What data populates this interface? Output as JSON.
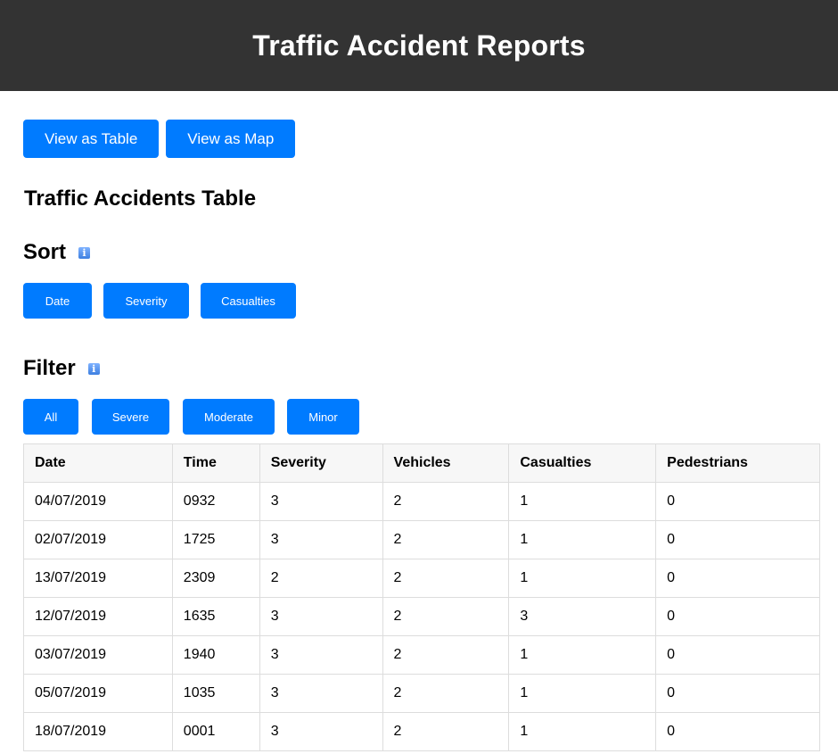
{
  "header": {
    "title": "Traffic Accident Reports"
  },
  "view_buttons": {
    "table": "View as Table",
    "map": "View as Map"
  },
  "table_title": "Traffic Accidents Table",
  "sort": {
    "label": "Sort",
    "buttons": [
      "Date",
      "Severity",
      "Casualties"
    ]
  },
  "filter": {
    "label": "Filter",
    "buttons": [
      "All",
      "Severe",
      "Moderate",
      "Minor"
    ]
  },
  "info_icon_glyph": "i",
  "table": {
    "headers": [
      "Date",
      "Time",
      "Severity",
      "Vehicles",
      "Casualties",
      "Pedestrians"
    ],
    "rows": [
      [
        "04/07/2019",
        "0932",
        "3",
        "2",
        "1",
        "0"
      ],
      [
        "02/07/2019",
        "1725",
        "3",
        "2",
        "1",
        "0"
      ],
      [
        "13/07/2019",
        "2309",
        "2",
        "2",
        "1",
        "0"
      ],
      [
        "12/07/2019",
        "1635",
        "3",
        "2",
        "3",
        "0"
      ],
      [
        "03/07/2019",
        "1940",
        "3",
        "2",
        "1",
        "0"
      ],
      [
        "05/07/2019",
        "1035",
        "3",
        "2",
        "1",
        "0"
      ],
      [
        "18/07/2019",
        "0001",
        "3",
        "2",
        "1",
        "0"
      ]
    ]
  }
}
